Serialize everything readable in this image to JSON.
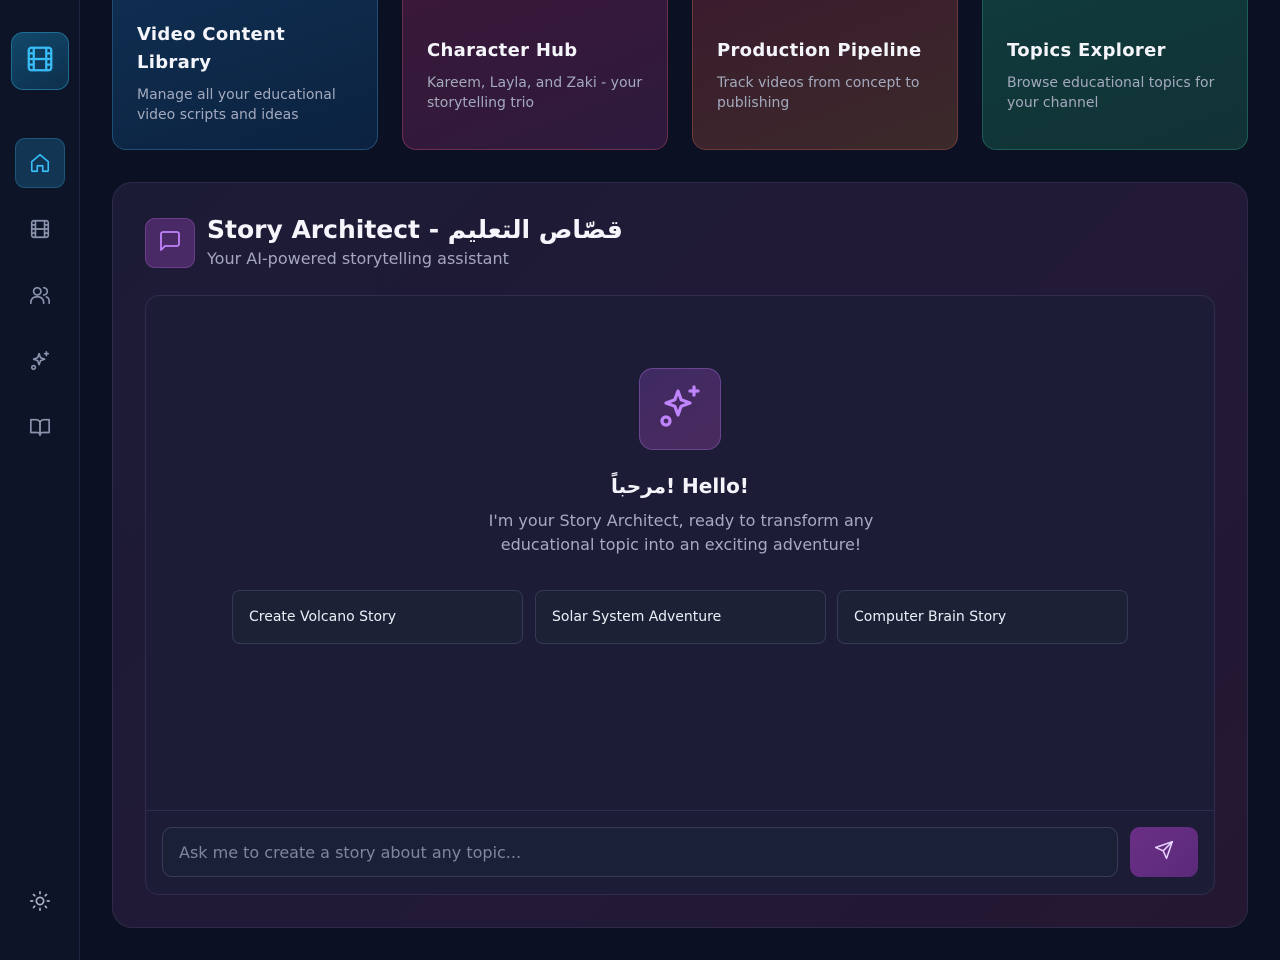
{
  "cards": [
    {
      "title": "Video Content Library",
      "desc": "Manage all your educational video scripts and ideas"
    },
    {
      "title": "Character Hub",
      "desc": "Kareem, Layla, and Zaki - your storytelling trio"
    },
    {
      "title": "Production Pipeline",
      "desc": "Track videos from concept to publishing"
    },
    {
      "title": "Topics Explorer",
      "desc": "Browse educational topics for your channel"
    }
  ],
  "panel": {
    "title": "Story Architect - قصّاص التعليم",
    "subtitle": "Your AI-powered storytelling assistant"
  },
  "chat": {
    "greeting": "مرحباً! Hello!",
    "intro": "I'm your Story Architect, ready to transform any educational topic into an exciting adventure!",
    "suggestions": [
      "Create Volcano Story",
      "Solar System Adventure",
      "Computer Brain Story"
    ],
    "input_placeholder": "Ask me to create a story about any topic..."
  },
  "icons": {
    "logo": "film-icon",
    "nav": [
      "home-icon",
      "film-icon",
      "users-icon",
      "sparkles-icon",
      "book-icon"
    ],
    "theme": "sun-icon",
    "panel": "message-square-icon",
    "hero": "sparkles-icon",
    "send": "send-icon"
  },
  "colors": {
    "accent_cyan": "#38bdf8",
    "accent_purple": "#c084fc"
  }
}
